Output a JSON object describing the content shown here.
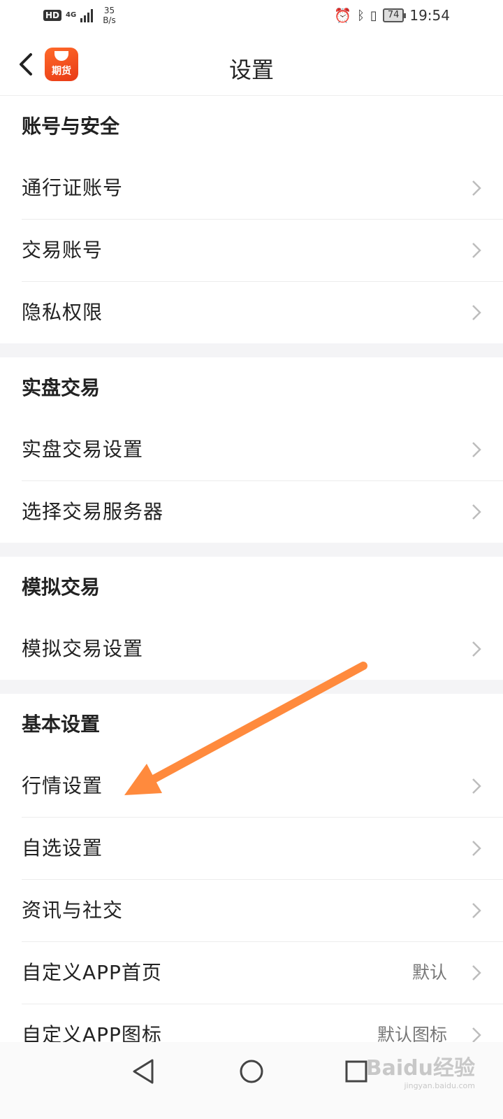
{
  "status_bar": {
    "hd": "HD",
    "network": "4G",
    "speed_value": "35",
    "speed_unit": "B/s",
    "battery": "74",
    "time": "19:54"
  },
  "header": {
    "title": "设置",
    "app_logo_text": "期货"
  },
  "sections": [
    {
      "title": "账号与安全",
      "items": [
        {
          "label": "通行证账号",
          "value": ""
        },
        {
          "label": "交易账号",
          "value": ""
        },
        {
          "label": "隐私权限",
          "value": ""
        }
      ]
    },
    {
      "title": "实盘交易",
      "items": [
        {
          "label": "实盘交易设置",
          "value": ""
        },
        {
          "label": "选择交易服务器",
          "value": ""
        }
      ]
    },
    {
      "title": "模拟交易",
      "items": [
        {
          "label": "模拟交易设置",
          "value": ""
        }
      ]
    },
    {
      "title": "基本设置",
      "items": [
        {
          "label": "行情设置",
          "value": ""
        },
        {
          "label": "自选设置",
          "value": ""
        },
        {
          "label": "资讯与社交",
          "value": ""
        },
        {
          "label": "自定义APP首页",
          "value": "默认"
        },
        {
          "label": "自定义APP图标",
          "value": "默认图标"
        }
      ]
    }
  ],
  "watermark": {
    "brand": "Baidu经验",
    "url": "jingyan.baidu.com"
  },
  "colors": {
    "accent": "#ff7a2f",
    "annotation_arrow": "#ff8a3d",
    "section_gap": "#f4f4f6",
    "divider": "#ececec"
  }
}
